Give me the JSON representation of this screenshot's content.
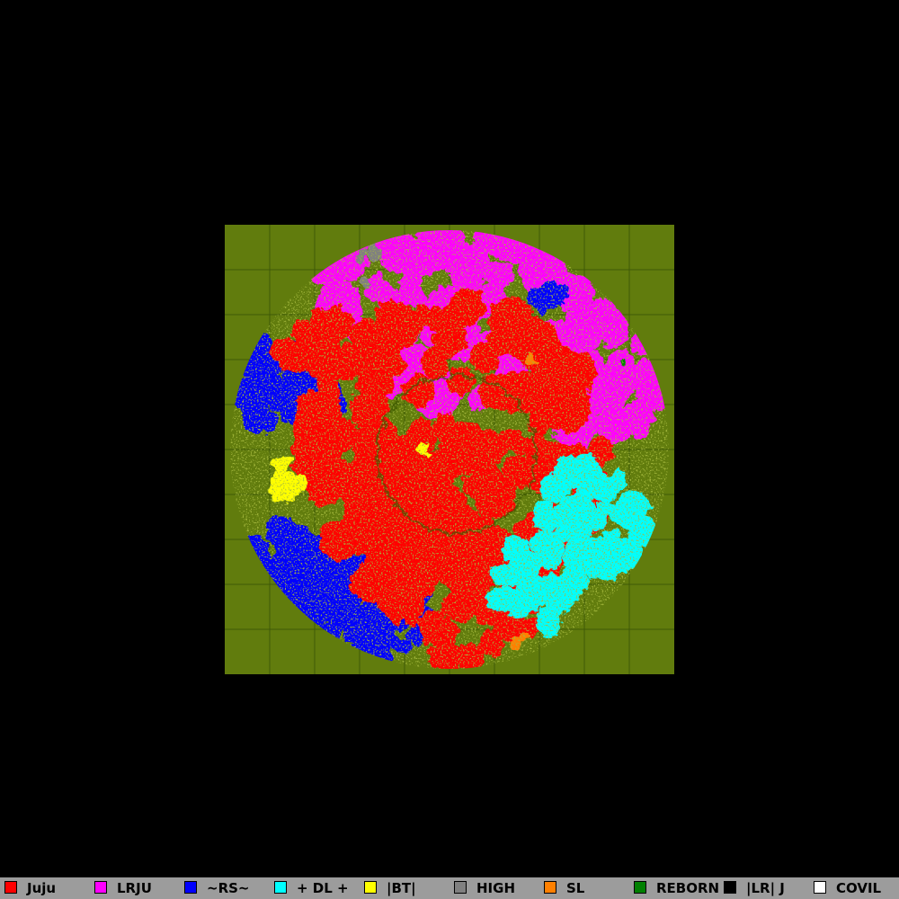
{
  "board": {
    "background_color": "#000000",
    "field_color": "#617c0d",
    "grid_color": "#3e5a08"
  },
  "players": [
    {
      "name": "Juju",
      "color": "#ff0000"
    },
    {
      "name": "LRJU",
      "color": "#ff00ff"
    },
    {
      "name": "~RS~",
      "color": "#0000ff"
    },
    {
      "name": "+ DL +",
      "color": "#00ffff"
    },
    {
      "name": "|BT|",
      "color": "#ffff00"
    },
    {
      "name": "HIGH",
      "color": "#808080"
    },
    {
      "name": "SL",
      "color": "#ff8000"
    },
    {
      "name": "REBORN",
      "color": "#008000"
    },
    {
      "name": "|LR| J",
      "color": "#000000"
    },
    {
      "name": "COVIL",
      "color": "#ffffff"
    }
  ]
}
